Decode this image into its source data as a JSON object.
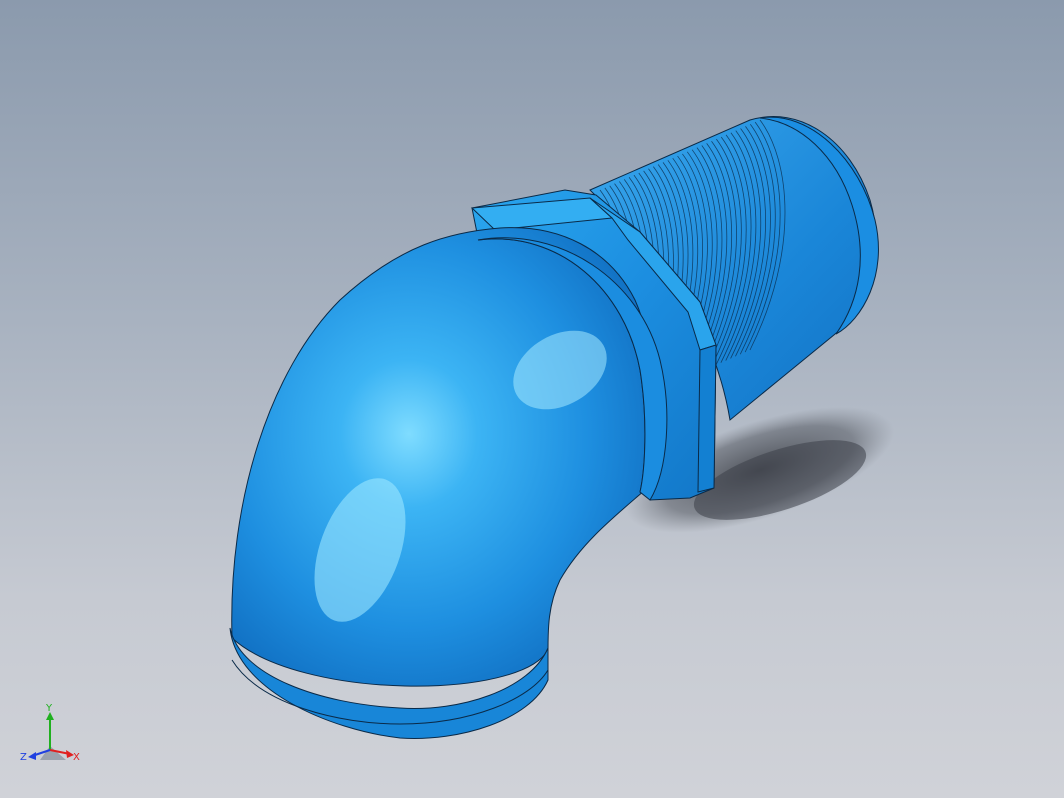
{
  "viewport": {
    "background_top": "#8b9aad",
    "background_bottom": "#d0d2d8"
  },
  "model": {
    "part": "elbow-fitting",
    "color_base": "#1e8fe0",
    "color_light": "#4cc4ff",
    "color_dark": "#0e6fc0",
    "edge_color": "#0a2a48"
  },
  "triad": {
    "x_label": "X",
    "y_label": "Y",
    "z_label": "Z",
    "x_color": "#e02020",
    "y_color": "#20b020",
    "z_color": "#2040e0"
  }
}
